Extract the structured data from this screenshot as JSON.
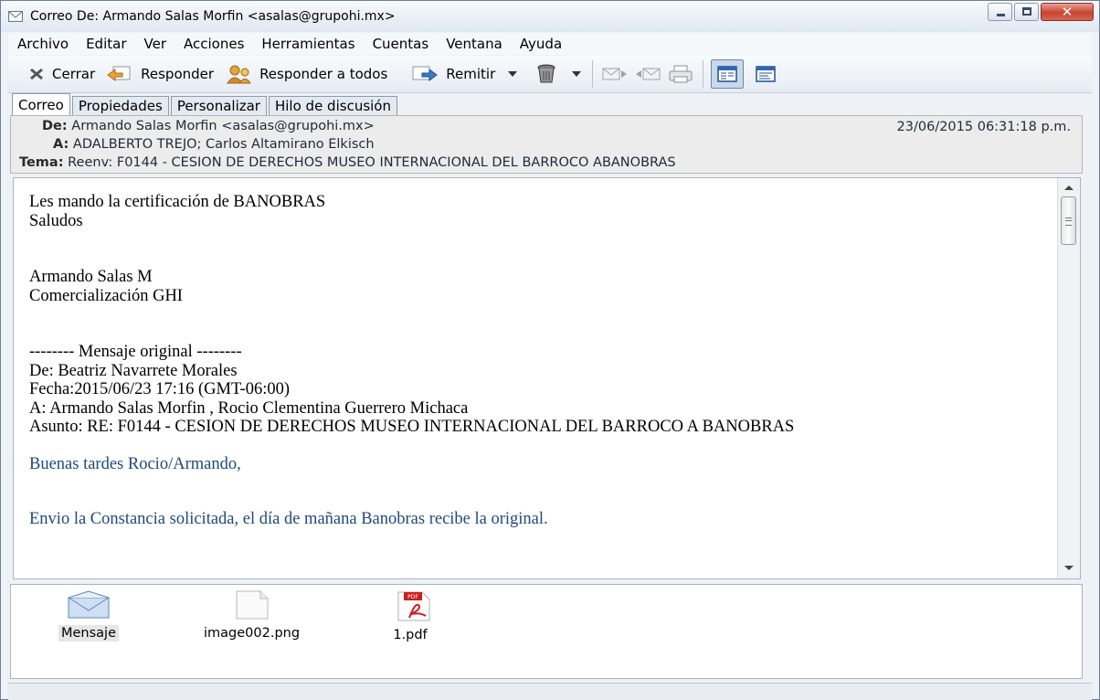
{
  "window": {
    "title": "Correo De: Armando Salas Morfin <asalas@grupohi.mx>"
  },
  "menu": [
    "Archivo",
    "Editar",
    "Ver",
    "Acciones",
    "Herramientas",
    "Cuentas",
    "Ventana",
    "Ayuda"
  ],
  "toolbar": {
    "close": "Cerrar",
    "reply": "Responder",
    "reply_all": "Responder a todos",
    "forward": "Remitir"
  },
  "tabs": [
    "Correo",
    "Propiedades",
    "Personalizar",
    "Hilo de discusión"
  ],
  "header": {
    "from_label": "De:",
    "from": "Armando Salas Morfin <asalas@grupohi.mx>",
    "to_label": "A:",
    "to": "ADALBERTO TREJO; Carlos Altamirano Elkisch",
    "subject_label": "Tema:",
    "subject": "Reenv: F0144 - CESION DE DERECHOS MUSEO INTERNACIONAL DEL BARROCO ABANOBRAS",
    "date": "23/06/2015 06:31:18 p.m."
  },
  "body": {
    "line1": "Les mando la certificación de BANOBRAS",
    "line2": "Saludos",
    "sig1": "Armando Salas M",
    "sig2": "Comercialización GHI",
    "orig_header": "-------- Mensaje original --------",
    "orig_from": "De: Beatriz Navarrete Morales",
    "orig_date": "Fecha:2015/06/23 17:16 (GMT-06:00)",
    "orig_to": "A: Armando Salas Morfin , Rocio Clementina Guerrero Michaca",
    "orig_subject": "Asunto: RE: F0144 - CESION DE DERECHOS MUSEO INTERNACIONAL DEL BARROCO A BANOBRAS",
    "greeting": "Buenas tardes Rocio/Armando,",
    "message": "Envio la Constancia solicitada, el día de mañana Banobras recibe la original."
  },
  "attachments": [
    {
      "name": "Mensaje",
      "icon": "envelope-icon"
    },
    {
      "name": "image002.png",
      "icon": "image-file-icon"
    },
    {
      "name": "1.pdf",
      "icon": "pdf-file-icon"
    }
  ]
}
